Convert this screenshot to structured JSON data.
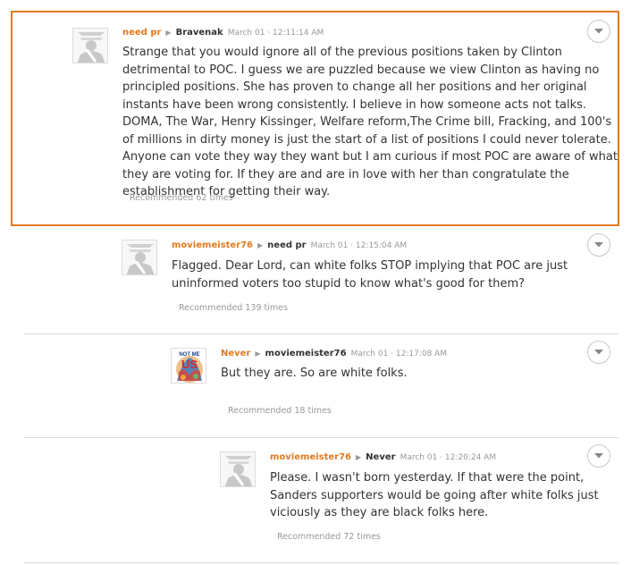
{
  "comments": [
    {
      "author": "need pr",
      "reply_to": "Bravenak",
      "timestamp": "March 01 · 12:11:14 AM",
      "body": "Strange that you would ignore all of the previous positions taken by Clinton detrimental to POC. I guess we are puzzled because we view Clinton as having no principled positions. She has proven to change all her positions and her original instants have been wrong consistently. I believe in how someone acts not talks. DOMA, The War, Henry Kissinger, Welfare reform,The Crime bill, Fracking, and 100's of millions in dirty money is just the start of a list of positions I could never tolerate. Anyone can vote they way they want but I am curious if most POC are aware of what they are voting for. If they are and are in love with her than congratulate the establishment for getting their way.",
      "recommended": "Recommended 62 times",
      "avatar_icon": "default-avatar-icon",
      "highlighted": true
    },
    {
      "author": "moviemeister76",
      "reply_to": "need pr",
      "timestamp": "March 01 · 12:15:04 AM",
      "body": "Flagged. Dear Lord, can white folks STOP implying that POC are just uninformed voters too stupid to know what's good for them?",
      "recommended": "Recommended 139 times",
      "avatar_icon": "default-avatar-icon"
    },
    {
      "author": "Never",
      "reply_to": "moviemeister76",
      "timestamp": "March 01 · 12:17:08 AM",
      "body": "But they are. So are white folks.",
      "recommended": "Recommended 18 times",
      "avatar_icon": "not-me-us-avatar-icon",
      "avatar_text_top": "NOT ME",
      "avatar_text_main": "US"
    },
    {
      "author": "moviemeister76",
      "reply_to": "Never",
      "timestamp": "March 01 · 12:20:24 AM",
      "body": "Please. I wasn't born yesterday. If that were the point, Sanders supporters would be going after white folks just viciously as they are black folks here.",
      "recommended": "Recommended 72 times",
      "avatar_icon": "default-avatar-icon"
    }
  ],
  "colors": {
    "accent": "#e07b20",
    "text": "#333333",
    "muted": "#999999",
    "divider": "#dcdcdc"
  },
  "icons": {
    "menu": "chevron-down-icon",
    "arrow": "reply-arrow-icon"
  }
}
